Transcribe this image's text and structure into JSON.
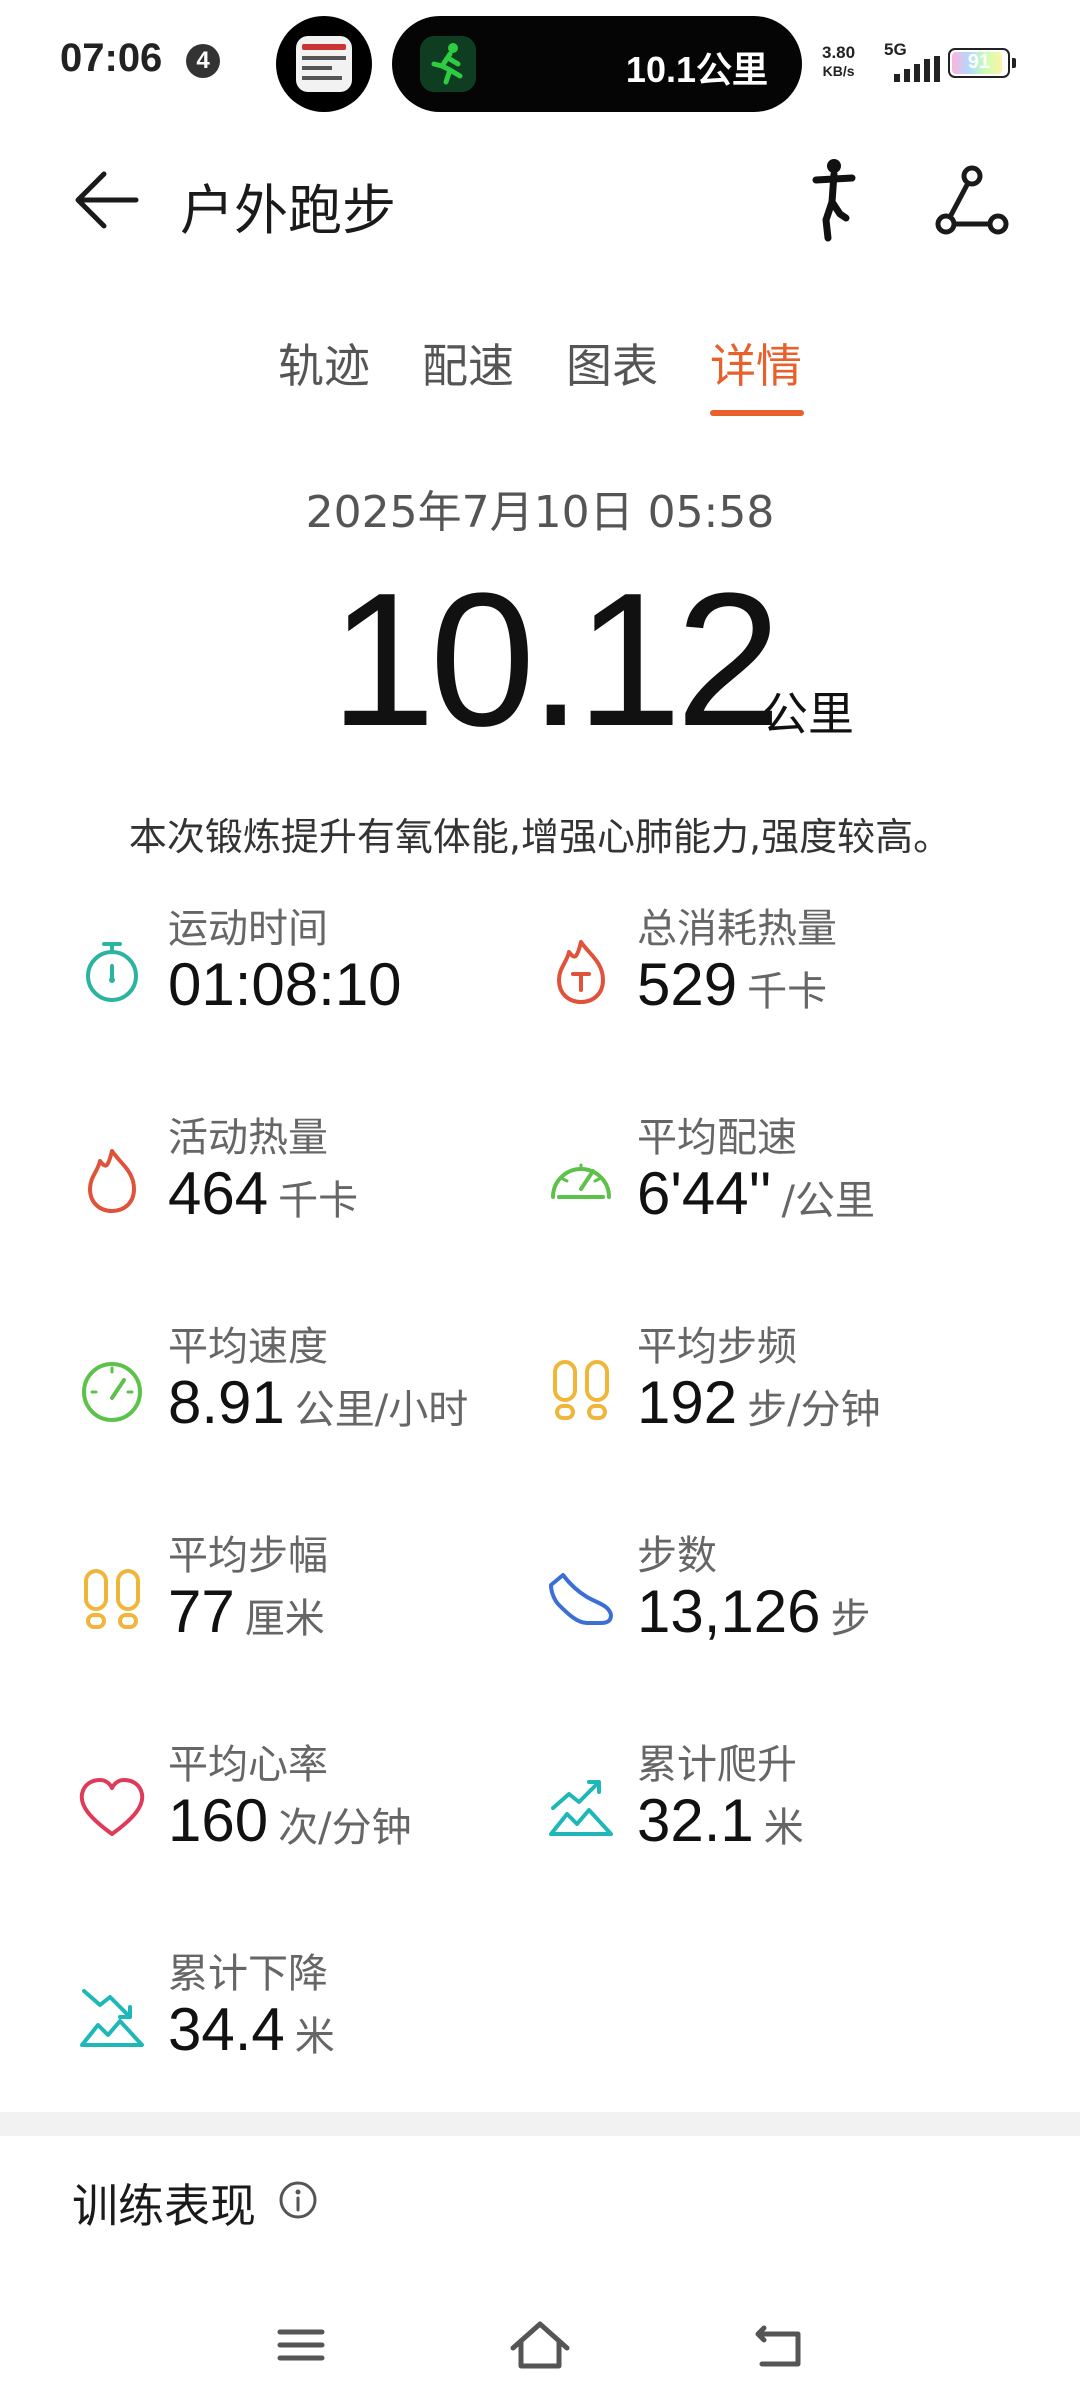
{
  "status_bar": {
    "time": "07:06",
    "notification_count": "4",
    "island_distance": "10.1公里",
    "net_speed_value": "3.80",
    "net_speed_unit": "KB/s",
    "network_type": "5G",
    "battery_level": "91"
  },
  "header": {
    "title": "户外跑步"
  },
  "tabs": [
    {
      "label": "轨迹",
      "active": false
    },
    {
      "label": "配速",
      "active": false
    },
    {
      "label": "图表",
      "active": false
    },
    {
      "label": "详情",
      "active": true
    }
  ],
  "summary": {
    "datetime": "2025年7月10日 05:58",
    "distance": "10.12",
    "distance_unit": "公里",
    "description": "本次锻炼提升有氧体能,增强心肺能力,强度较高。"
  },
  "metrics": [
    {
      "label": "运动时间",
      "value": "01:08:10",
      "unit": "",
      "icon": "stopwatch-icon",
      "color": "#2bb5a0"
    },
    {
      "label": "总消耗热量",
      "value": "529",
      "unit": "千卡",
      "icon": "flame-total-icon",
      "color": "#e0533a"
    },
    {
      "label": "活动热量",
      "value": "464",
      "unit": "千卡",
      "icon": "flame-icon",
      "color": "#e0533a"
    },
    {
      "label": "平均配速",
      "value": "6'44''",
      "unit": "/公里",
      "icon": "speedometer-icon",
      "color": "#5cc24a"
    },
    {
      "label": "平均速度",
      "value": "8.91",
      "unit": "公里/小时",
      "icon": "speedometer-icon",
      "color": "#5cc24a"
    },
    {
      "label": "平均步频",
      "value": "192",
      "unit": "步/分钟",
      "icon": "footprints-icon",
      "color": "#f0b63a"
    },
    {
      "label": "平均步幅",
      "value": "77",
      "unit": "厘米",
      "icon": "footprints-icon",
      "color": "#f0b63a"
    },
    {
      "label": "步数",
      "value": "13,126",
      "unit": "步",
      "icon": "shoe-icon",
      "color": "#3a6fd8"
    },
    {
      "label": "平均心率",
      "value": "160",
      "unit": "次/分钟",
      "icon": "heart-icon",
      "color": "#e03a5a"
    },
    {
      "label": "累计爬升",
      "value": "32.1",
      "unit": "米",
      "icon": "ascent-icon",
      "color": "#1fb8b8"
    },
    {
      "label": "累计下降",
      "value": "34.4",
      "unit": "米",
      "icon": "descent-icon",
      "color": "#1fb8b8"
    }
  ],
  "section": {
    "title": "训练表现"
  }
}
